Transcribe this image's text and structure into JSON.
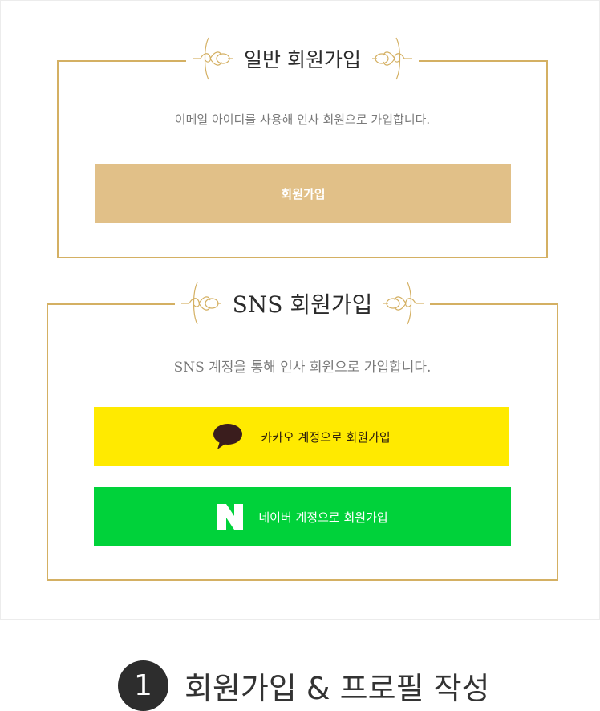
{
  "general_signup": {
    "title": "일반 회원가입",
    "description": "이메일 아이디를 사용해 인사 회원으로 가입합니다.",
    "button_label": "회원가입"
  },
  "sns_signup": {
    "title": "SNS 회원가입",
    "description": "SNS 계정을 통해 인사 회원으로 가입합니다.",
    "kakao_button_label": "카카오 계정으로 회원가입",
    "naver_button_label": "네이버 계정으로 회원가입"
  },
  "footer": {
    "step_number": "1",
    "title": "회원가입 & 프로필 작성"
  },
  "icons": {
    "kakao": "kakao-speech-bubble-icon",
    "naver": "naver-n-icon",
    "ornament": "flourish-ornament-icon"
  },
  "colors": {
    "gold_border": "#d4b063",
    "general_button": "#e1c088",
    "kakao_yellow": "#ffea00",
    "naver_green": "#00d23a",
    "step_circle": "#2d2d2d"
  }
}
